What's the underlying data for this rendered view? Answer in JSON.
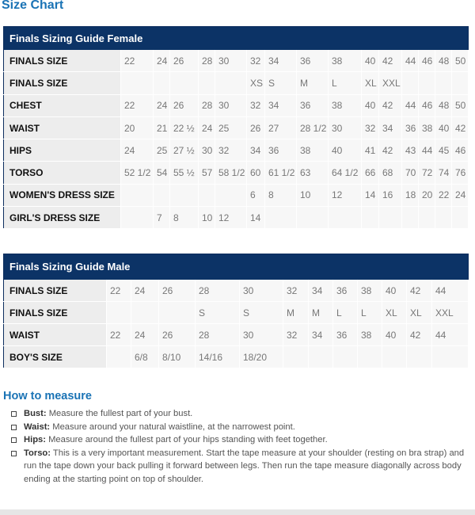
{
  "page_title": "Size Chart",
  "female": {
    "title": "Finals Sizing Guide Female",
    "rows": [
      {
        "label": "FINALS SIZE",
        "cells": [
          "22",
          "24",
          "26",
          "28",
          "30",
          "32",
          "34",
          "36",
          "38",
          "40",
          "42",
          "44",
          "46",
          "48",
          "50"
        ]
      },
      {
        "label": "FINALS SIZE",
        "cells": [
          "",
          "",
          "",
          "",
          "",
          "XS",
          "S",
          "M",
          "L",
          "XL",
          "XXL",
          "",
          "",
          "",
          ""
        ]
      },
      {
        "label": "CHEST",
        "cells": [
          "22",
          "24",
          "26",
          "28",
          "30",
          "32",
          "34",
          "36",
          "38",
          "40",
          "42",
          "44",
          "46",
          "48",
          "50"
        ]
      },
      {
        "label": "WAIST",
        "cells": [
          "20",
          "21",
          "22 ½",
          "24",
          "25",
          "26",
          "27",
          "28 1/2",
          "30",
          "32",
          "34",
          "36",
          "38",
          "40",
          "42"
        ]
      },
      {
        "label": "HIPS",
        "cells": [
          "24",
          "25",
          "27 ½",
          "30",
          "32",
          "34",
          "36",
          "38",
          "40",
          "41",
          "42",
          "43",
          "44",
          "45",
          "46"
        ]
      },
      {
        "label": "TORSO",
        "cells": [
          "52 1/2",
          "54",
          "55 ½",
          "57",
          "58 1/2",
          "60",
          "61 1/2",
          "63",
          "64 1/2",
          "66",
          "68",
          "70",
          "72",
          "74",
          "76"
        ]
      },
      {
        "label": "WOMEN'S DRESS SIZE",
        "cells": [
          "",
          "",
          "",
          "",
          "",
          "6",
          "8",
          "10",
          "12",
          "14",
          "16",
          "18",
          "20",
          "22",
          "24"
        ]
      },
      {
        "label": "GIRL'S DRESS SIZE",
        "cells": [
          "",
          "7",
          "8",
          "10",
          "12",
          "14",
          "",
          "",
          "",
          "",
          "",
          "",
          "",
          "",
          ""
        ]
      }
    ]
  },
  "male": {
    "title": "Finals Sizing Guide Male",
    "rows": [
      {
        "label": "FINALS SIZE",
        "cells": [
          "22",
          "24",
          "26",
          "28",
          "30",
          "32",
          "34",
          "36",
          "38",
          "40",
          "42",
          "44"
        ]
      },
      {
        "label": "FINALS SIZE",
        "cells": [
          "",
          "",
          "",
          "S",
          "S",
          "M",
          "M",
          "L",
          "L",
          "XL",
          "XL",
          "XXL"
        ]
      },
      {
        "label": "WAIST",
        "cells": [
          "22",
          "24",
          "26",
          "28",
          "30",
          "32",
          "34",
          "36",
          "38",
          "40",
          "42",
          "44"
        ]
      },
      {
        "label": "BOY'S SIZE",
        "cells": [
          "",
          "6/8",
          "8/10",
          "14/16",
          "18/20",
          "",
          "",
          "",
          "",
          "",
          "",
          ""
        ]
      }
    ]
  },
  "how_to_measure": {
    "title": "How to measure",
    "items": [
      {
        "term": "Bust:",
        "text": " Measure the fullest part of your bust."
      },
      {
        "term": "Waist:",
        "text": " Measure around your natural waistline, at the narrowest point."
      },
      {
        "term": "Hips:",
        "text": " Measure around the fullest part of your hips standing with feet together."
      },
      {
        "term": "Torso:",
        "text": " This is a very important measurement. Start the tape measure at your shoulder (resting on bra strap) and run the tape down your back pulling it forward between legs. Then run the tape measure diagonally across body ending at the starting point on top of shoulder."
      }
    ]
  },
  "colors": {
    "accent": "#1a73b5",
    "header_bg": "#0c3366"
  }
}
